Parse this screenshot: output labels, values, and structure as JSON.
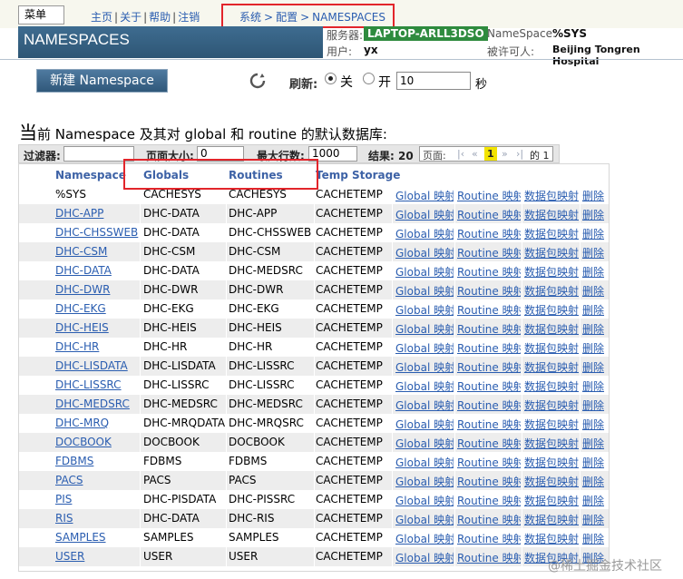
{
  "topbar": {
    "menu_label": "菜单",
    "links": [
      "主页",
      "关于",
      "帮助",
      "注销"
    ],
    "breadcrumb": [
      "系统",
      "配置",
      "NAMESPACES"
    ]
  },
  "title": "NAMESPACES",
  "info": {
    "server_label": "服务器:",
    "server_value": "LAPTOP-ARLL3DSO",
    "user_label": "用户:",
    "user_value": "yx",
    "namespace_label": "NameSpace:",
    "namespace_value": "%SYS",
    "licensee_label": "被许可人:",
    "licensee_value": "Beijing Tongren Hospital"
  },
  "toolbar": {
    "new_button": "新建 Namespace",
    "refresh_label": "刷新:",
    "off_label": "关",
    "on_label": "开",
    "interval_value": "10",
    "seconds_label": "秒"
  },
  "heading": {
    "first_char": "当",
    "rest": "前 Namespace 及其对 global 和 routine 的默认数据库:"
  },
  "filter": {
    "filter_label": "过滤器:",
    "filter_value": "",
    "page_size_label": "页面大小:",
    "page_size_value": "0",
    "max_rows_label": "最大行数:",
    "max_rows_value": "1000",
    "results_label": "结果: 20",
    "page_label": "页面:",
    "current_page": "1",
    "of_label": "的 1"
  },
  "table": {
    "headers": [
      "Namespace",
      "Globals",
      "Routines",
      "Temp Storage"
    ],
    "actions": [
      "Global 映射",
      "Routine 映射",
      "数据包映射",
      "删除"
    ],
    "rows": [
      {
        "ns": "%SYS",
        "globals": "CACHESYS",
        "routines": "CACHESYS",
        "temp": "CACHETEMP"
      },
      {
        "ns": "DHC-APP",
        "globals": "DHC-DATA",
        "routines": "DHC-APP",
        "temp": "CACHETEMP"
      },
      {
        "ns": "DHC-CHSSWEB",
        "globals": "DHC-DATA",
        "routines": "DHC-CHSSWEB",
        "temp": "CACHETEMP"
      },
      {
        "ns": "DHC-CSM",
        "globals": "DHC-CSM",
        "routines": "DHC-CSM",
        "temp": "CACHETEMP"
      },
      {
        "ns": "DHC-DATA",
        "globals": "DHC-DATA",
        "routines": "DHC-MEDSRC",
        "temp": "CACHETEMP"
      },
      {
        "ns": "DHC-DWR",
        "globals": "DHC-DWR",
        "routines": "DHC-DWR",
        "temp": "CACHETEMP"
      },
      {
        "ns": "DHC-EKG",
        "globals": "DHC-EKG",
        "routines": "DHC-EKG",
        "temp": "CACHETEMP"
      },
      {
        "ns": "DHC-HEIS",
        "globals": "DHC-HEIS",
        "routines": "DHC-HEIS",
        "temp": "CACHETEMP"
      },
      {
        "ns": "DHC-HR",
        "globals": "DHC-HR",
        "routines": "DHC-HR",
        "temp": "CACHETEMP"
      },
      {
        "ns": "DHC-LISDATA",
        "globals": "DHC-LISDATA",
        "routines": "DHC-LISSRC",
        "temp": "CACHETEMP"
      },
      {
        "ns": "DHC-LISSRC",
        "globals": "DHC-LISSRC",
        "routines": "DHC-LISSRC",
        "temp": "CACHETEMP"
      },
      {
        "ns": "DHC-MEDSRC",
        "globals": "DHC-MEDSRC",
        "routines": "DHC-MEDSRC",
        "temp": "CACHETEMP"
      },
      {
        "ns": "DHC-MRQ",
        "globals": "DHC-MRQDATA",
        "routines": "DHC-MRQSRC",
        "temp": "CACHETEMP"
      },
      {
        "ns": "DOCBOOK",
        "globals": "DOCBOOK",
        "routines": "DOCBOOK",
        "temp": "CACHETEMP"
      },
      {
        "ns": "FDBMS",
        "globals": "FDBMS",
        "routines": "FDBMS",
        "temp": "CACHETEMP"
      },
      {
        "ns": "PACS",
        "globals": "PACS",
        "routines": "PACS",
        "temp": "CACHETEMP"
      },
      {
        "ns": "PIS",
        "globals": "DHC-PISDATA",
        "routines": "DHC-PISSRC",
        "temp": "CACHETEMP"
      },
      {
        "ns": "RIS",
        "globals": "DHC-DATA",
        "routines": "DHC-RIS",
        "temp": "CACHETEMP"
      },
      {
        "ns": "SAMPLES",
        "globals": "SAMPLES",
        "routines": "SAMPLES",
        "temp": "CACHETEMP"
      },
      {
        "ns": "USER",
        "globals": "USER",
        "routines": "USER",
        "temp": "CACHETEMP"
      }
    ]
  },
  "watermark": "@稀土掘金技术社区",
  "colors": {
    "link": "#2a5db0",
    "title_band": "#30587a",
    "server_badge": "#2e8b3e",
    "highlight_box": "#e2252b",
    "row_alt": "#ededed",
    "current_page": "#f2e300"
  }
}
